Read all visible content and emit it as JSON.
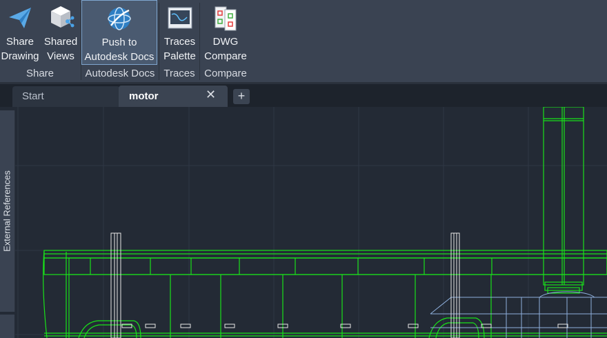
{
  "ribbon": {
    "buttons": [
      {
        "label": "Share\nDrawing",
        "icon": "paper-plane-icon"
      },
      {
        "label": "Shared\nViews",
        "icon": "shared-views-cube-icon"
      },
      {
        "label": "Push to\nAutodesk Docs",
        "icon": "autodesk-docs-globe-icon"
      },
      {
        "label": "Traces\nPalette",
        "icon": "traces-palette-icon"
      },
      {
        "label": "DWG\nCompare",
        "icon": "dwg-compare-icon"
      }
    ],
    "groups": [
      "Share",
      "Autodesk Docs",
      "Traces",
      "Compare"
    ]
  },
  "tabs": {
    "start": "Start",
    "active": "motor",
    "close_icon": "close-icon",
    "new_tab_icon": "plus-icon"
  },
  "side_palette": {
    "label": "External References"
  },
  "colors": {
    "ribbon_bg": "#3a4352",
    "canvas_bg": "#232a35",
    "wire_green": "#19e219",
    "wire_white": "#e8e8e8",
    "wire_blue": "#8fb0dd"
  }
}
